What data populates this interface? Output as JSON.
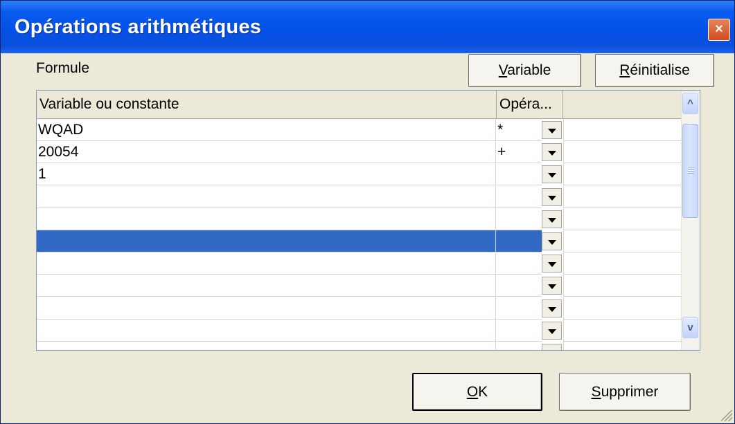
{
  "window": {
    "title": "Opérations arithmétiques",
    "close_glyph": "×"
  },
  "formule_label": "Formule",
  "buttons": {
    "variable": {
      "mnemonic": "V",
      "rest": "ariable"
    },
    "reinitialise": {
      "mnemonic": "R",
      "rest": "éinitialise"
    },
    "ok": {
      "mnemonic": "O",
      "rest": "K"
    },
    "supprimer": {
      "mnemonic": "S",
      "rest": "upprimer"
    }
  },
  "grid": {
    "columns": [
      "Variable ou constante",
      "Opéra..."
    ],
    "rows": [
      {
        "value": "WQAD",
        "op": "*"
      },
      {
        "value": "20054",
        "op": "+"
      },
      {
        "value": "1",
        "op": ""
      },
      {
        "value": "",
        "op": ""
      },
      {
        "value": "",
        "op": ""
      },
      {
        "value": "",
        "op": "",
        "selected": true
      },
      {
        "value": "",
        "op": ""
      },
      {
        "value": "",
        "op": ""
      },
      {
        "value": "",
        "op": ""
      },
      {
        "value": "",
        "op": ""
      },
      {
        "value": "",
        "op": ""
      }
    ],
    "dropdown_icon": "chevron-down-icon"
  },
  "scrollbar": {
    "up_glyph": "^",
    "down_glyph": "v"
  },
  "colors": {
    "title_bar": "#0451e8",
    "selection": "#316ac5",
    "face": "#ece9d8",
    "close": "#d14b1e"
  }
}
